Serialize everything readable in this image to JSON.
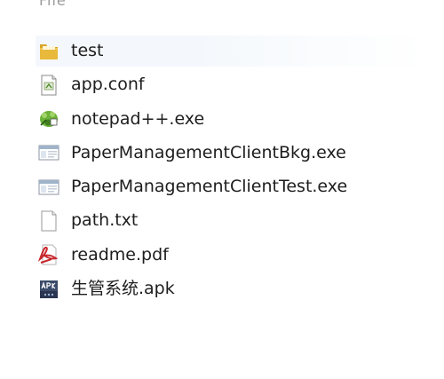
{
  "header_fragment": "File",
  "files": [
    {
      "name": "test",
      "icon": "folder-icon"
    },
    {
      "name": "app.conf",
      "icon": "config-file-icon"
    },
    {
      "name": "notepad++.exe",
      "icon": "notepad-plus-plus-icon"
    },
    {
      "name": "PaperManagementClientBkg.exe",
      "icon": "application-window-icon"
    },
    {
      "name": "PaperManagementClientTest.exe",
      "icon": "application-window-icon"
    },
    {
      "name": "path.txt",
      "icon": "text-file-icon"
    },
    {
      "name": "readme.pdf",
      "icon": "pdf-file-icon"
    },
    {
      "name": "生管系统.apk",
      "icon": "apk-file-icon"
    }
  ],
  "colors": {
    "folder": "#e8b93a",
    "pdf": "#c8262c",
    "notepad": "#5aa02c",
    "apk": "#3a4a6a"
  }
}
